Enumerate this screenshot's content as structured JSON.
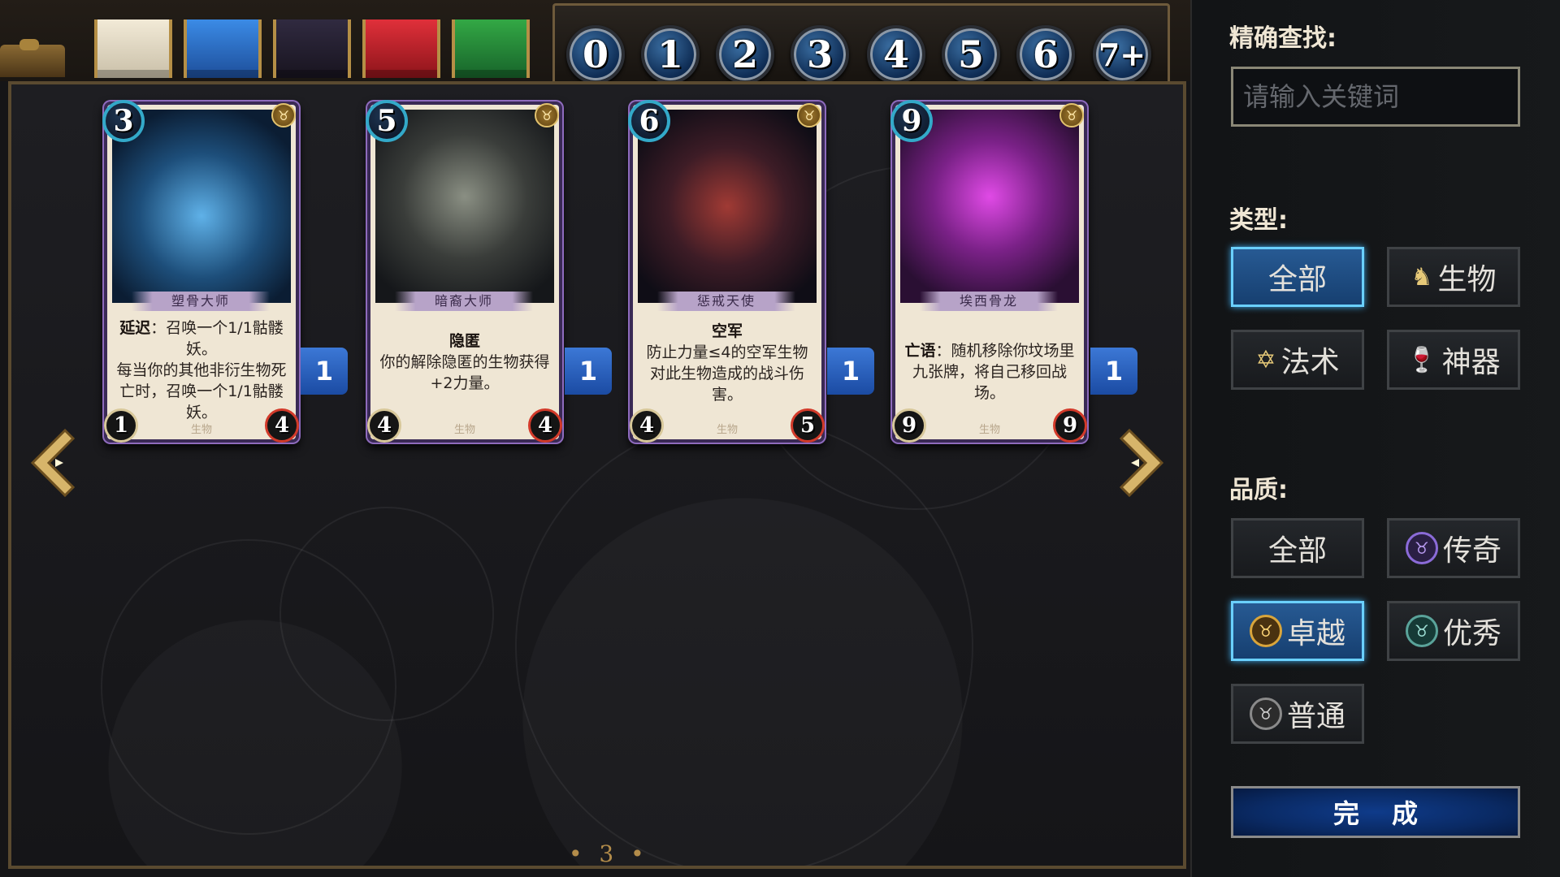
{
  "cost_filter": {
    "values": [
      "0",
      "1",
      "2",
      "3",
      "4",
      "5",
      "6",
      "7+"
    ],
    "colors": [
      "#f2ead7",
      "#2f7dd6",
      "#2a2236",
      "#c9242b",
      "#2a8f3a"
    ]
  },
  "cards": [
    {
      "cost": "3",
      "name": "塑骨大师",
      "text_kw": "延迟",
      "text": "：召唤一个1/1骷髅妖。",
      "text2": "每当你的其他非衍生物死亡时，召唤一个1/1骷髅妖。",
      "type": "生物",
      "attack": "1",
      "health": "4",
      "count": "1",
      "rarity_icon": "♉",
      "art_colors": [
        "#3c7fb5",
        "#0c2640"
      ]
    },
    {
      "cost": "5",
      "name": "暗裔大师",
      "text_kw": "隐匿",
      "text": "",
      "text2": "你的解除隐匿的生物获得+2力量。",
      "type": "生物",
      "attack": "4",
      "health": "4",
      "count": "1",
      "rarity_icon": "♉",
      "art_colors": [
        "#5f6a64",
        "#1c1e22"
      ]
    },
    {
      "cost": "6",
      "name": "惩戒天使",
      "text_kw": "空军",
      "text": "",
      "text2": "防止力量≤4的空军生物对此生物造成的战斗伤害。",
      "type": "生物",
      "attack": "4",
      "health": "5",
      "count": "1",
      "rarity_icon": "♉",
      "art_colors": [
        "#7a2d2a",
        "#15131d"
      ]
    },
    {
      "cost": "9",
      "name": "埃西骨龙",
      "text_kw": "亡语",
      "text": "：随机移除你坟场里九张牌，将自己移回战场。",
      "text2": "",
      "type": "生物",
      "attack": "9",
      "health": "9",
      "count": "1",
      "rarity_icon": "♉",
      "art_colors": [
        "#c233c9",
        "#2a0f33"
      ]
    }
  ],
  "page": "• 3 •",
  "panel": {
    "search_label": "精确查找:",
    "search_placeholder": "请输入关键词",
    "type_label": "类型:",
    "type_buttons": [
      {
        "label": "全部",
        "icon": ""
      },
      {
        "label": "生物",
        "icon": "♞"
      },
      {
        "label": "法术",
        "icon": "✡"
      },
      {
        "label": "神器",
        "icon": "🍷"
      }
    ],
    "quality_label": "品质:",
    "quality_buttons": [
      {
        "label": "全部",
        "icon": ""
      },
      {
        "label": "传奇",
        "icon": "♉",
        "color": "#8b6bd8"
      },
      {
        "label": "卓越",
        "icon": "♉",
        "color": "#d9a53b"
      },
      {
        "label": "优秀",
        "icon": "♉",
        "color": "#5aa39a"
      },
      {
        "label": "普通",
        "icon": "♉",
        "color": "#8a8a8a"
      }
    ],
    "done_label": "完成"
  }
}
